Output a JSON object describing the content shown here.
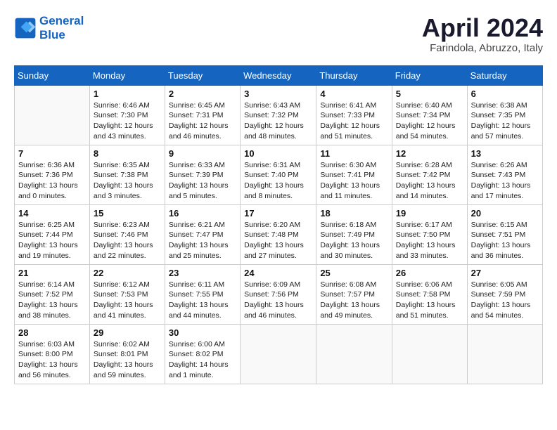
{
  "header": {
    "logo_line1": "General",
    "logo_line2": "Blue",
    "month": "April 2024",
    "location": "Farindola, Abruzzo, Italy"
  },
  "weekdays": [
    "Sunday",
    "Monday",
    "Tuesday",
    "Wednesday",
    "Thursday",
    "Friday",
    "Saturday"
  ],
  "weeks": [
    [
      {
        "day": "",
        "sunrise": "",
        "sunset": "",
        "daylight": ""
      },
      {
        "day": "1",
        "sunrise": "Sunrise: 6:46 AM",
        "sunset": "Sunset: 7:30 PM",
        "daylight": "Daylight: 12 hours and 43 minutes."
      },
      {
        "day": "2",
        "sunrise": "Sunrise: 6:45 AM",
        "sunset": "Sunset: 7:31 PM",
        "daylight": "Daylight: 12 hours and 46 minutes."
      },
      {
        "day": "3",
        "sunrise": "Sunrise: 6:43 AM",
        "sunset": "Sunset: 7:32 PM",
        "daylight": "Daylight: 12 hours and 48 minutes."
      },
      {
        "day": "4",
        "sunrise": "Sunrise: 6:41 AM",
        "sunset": "Sunset: 7:33 PM",
        "daylight": "Daylight: 12 hours and 51 minutes."
      },
      {
        "day": "5",
        "sunrise": "Sunrise: 6:40 AM",
        "sunset": "Sunset: 7:34 PM",
        "daylight": "Daylight: 12 hours and 54 minutes."
      },
      {
        "day": "6",
        "sunrise": "Sunrise: 6:38 AM",
        "sunset": "Sunset: 7:35 PM",
        "daylight": "Daylight: 12 hours and 57 minutes."
      }
    ],
    [
      {
        "day": "7",
        "sunrise": "Sunrise: 6:36 AM",
        "sunset": "Sunset: 7:36 PM",
        "daylight": "Daylight: 13 hours and 0 minutes."
      },
      {
        "day": "8",
        "sunrise": "Sunrise: 6:35 AM",
        "sunset": "Sunset: 7:38 PM",
        "daylight": "Daylight: 13 hours and 3 minutes."
      },
      {
        "day": "9",
        "sunrise": "Sunrise: 6:33 AM",
        "sunset": "Sunset: 7:39 PM",
        "daylight": "Daylight: 13 hours and 5 minutes."
      },
      {
        "day": "10",
        "sunrise": "Sunrise: 6:31 AM",
        "sunset": "Sunset: 7:40 PM",
        "daylight": "Daylight: 13 hours and 8 minutes."
      },
      {
        "day": "11",
        "sunrise": "Sunrise: 6:30 AM",
        "sunset": "Sunset: 7:41 PM",
        "daylight": "Daylight: 13 hours and 11 minutes."
      },
      {
        "day": "12",
        "sunrise": "Sunrise: 6:28 AM",
        "sunset": "Sunset: 7:42 PM",
        "daylight": "Daylight: 13 hours and 14 minutes."
      },
      {
        "day": "13",
        "sunrise": "Sunrise: 6:26 AM",
        "sunset": "Sunset: 7:43 PM",
        "daylight": "Daylight: 13 hours and 17 minutes."
      }
    ],
    [
      {
        "day": "14",
        "sunrise": "Sunrise: 6:25 AM",
        "sunset": "Sunset: 7:44 PM",
        "daylight": "Daylight: 13 hours and 19 minutes."
      },
      {
        "day": "15",
        "sunrise": "Sunrise: 6:23 AM",
        "sunset": "Sunset: 7:46 PM",
        "daylight": "Daylight: 13 hours and 22 minutes."
      },
      {
        "day": "16",
        "sunrise": "Sunrise: 6:21 AM",
        "sunset": "Sunset: 7:47 PM",
        "daylight": "Daylight: 13 hours and 25 minutes."
      },
      {
        "day": "17",
        "sunrise": "Sunrise: 6:20 AM",
        "sunset": "Sunset: 7:48 PM",
        "daylight": "Daylight: 13 hours and 27 minutes."
      },
      {
        "day": "18",
        "sunrise": "Sunrise: 6:18 AM",
        "sunset": "Sunset: 7:49 PM",
        "daylight": "Daylight: 13 hours and 30 minutes."
      },
      {
        "day": "19",
        "sunrise": "Sunrise: 6:17 AM",
        "sunset": "Sunset: 7:50 PM",
        "daylight": "Daylight: 13 hours and 33 minutes."
      },
      {
        "day": "20",
        "sunrise": "Sunrise: 6:15 AM",
        "sunset": "Sunset: 7:51 PM",
        "daylight": "Daylight: 13 hours and 36 minutes."
      }
    ],
    [
      {
        "day": "21",
        "sunrise": "Sunrise: 6:14 AM",
        "sunset": "Sunset: 7:52 PM",
        "daylight": "Daylight: 13 hours and 38 minutes."
      },
      {
        "day": "22",
        "sunrise": "Sunrise: 6:12 AM",
        "sunset": "Sunset: 7:53 PM",
        "daylight": "Daylight: 13 hours and 41 minutes."
      },
      {
        "day": "23",
        "sunrise": "Sunrise: 6:11 AM",
        "sunset": "Sunset: 7:55 PM",
        "daylight": "Daylight: 13 hours and 44 minutes."
      },
      {
        "day": "24",
        "sunrise": "Sunrise: 6:09 AM",
        "sunset": "Sunset: 7:56 PM",
        "daylight": "Daylight: 13 hours and 46 minutes."
      },
      {
        "day": "25",
        "sunrise": "Sunrise: 6:08 AM",
        "sunset": "Sunset: 7:57 PM",
        "daylight": "Daylight: 13 hours and 49 minutes."
      },
      {
        "day": "26",
        "sunrise": "Sunrise: 6:06 AM",
        "sunset": "Sunset: 7:58 PM",
        "daylight": "Daylight: 13 hours and 51 minutes."
      },
      {
        "day": "27",
        "sunrise": "Sunrise: 6:05 AM",
        "sunset": "Sunset: 7:59 PM",
        "daylight": "Daylight: 13 hours and 54 minutes."
      }
    ],
    [
      {
        "day": "28",
        "sunrise": "Sunrise: 6:03 AM",
        "sunset": "Sunset: 8:00 PM",
        "daylight": "Daylight: 13 hours and 56 minutes."
      },
      {
        "day": "29",
        "sunrise": "Sunrise: 6:02 AM",
        "sunset": "Sunset: 8:01 PM",
        "daylight": "Daylight: 13 hours and 59 minutes."
      },
      {
        "day": "30",
        "sunrise": "Sunrise: 6:00 AM",
        "sunset": "Sunset: 8:02 PM",
        "daylight": "Daylight: 14 hours and 1 minute."
      },
      {
        "day": "",
        "sunrise": "",
        "sunset": "",
        "daylight": ""
      },
      {
        "day": "",
        "sunrise": "",
        "sunset": "",
        "daylight": ""
      },
      {
        "day": "",
        "sunrise": "",
        "sunset": "",
        "daylight": ""
      },
      {
        "day": "",
        "sunrise": "",
        "sunset": "",
        "daylight": ""
      }
    ]
  ]
}
